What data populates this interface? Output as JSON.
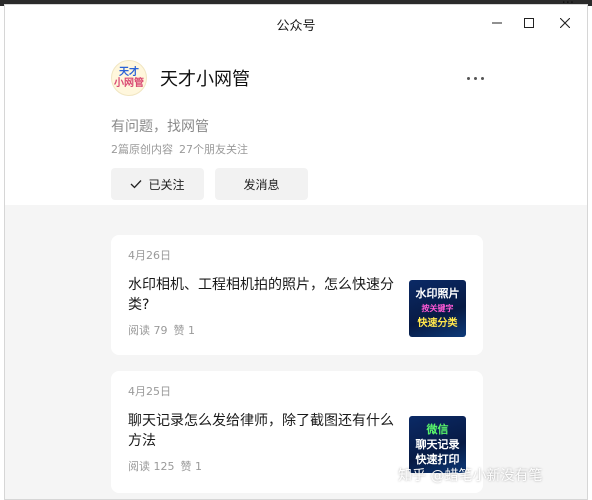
{
  "window": {
    "title": "公众号",
    "background_peek": "...",
    "controls": {
      "minimize_icon": "minimize-icon",
      "maximize_icon": "maximize-icon",
      "close_icon": "close-icon"
    }
  },
  "account": {
    "avatar_line1": "天才",
    "avatar_line2": "小网管",
    "name": "天才小网管",
    "intro": "有问题，找网管",
    "stats": {
      "original": "2篇原创内容",
      "friends": "27个朋友关注"
    }
  },
  "actions": {
    "follow_label": "已关注",
    "message_label": "发消息"
  },
  "articles": [
    {
      "date": "4月26日",
      "title": "水印相机、工程相机拍的照片，怎么快速分类?",
      "reads": "阅读 79",
      "likes": "赞 1",
      "thumb": [
        "水印照片",
        "按关键字",
        "快速分类"
      ]
    },
    {
      "date": "4月25日",
      "title": "聊天记录怎么发给律师，除了截图还有什么方法",
      "reads": "阅读 125",
      "likes": "赞 1",
      "thumb": [
        "微信",
        "聊天记录",
        "快速打印"
      ]
    }
  ],
  "watermark": "知乎 @蜡笔小新没有笔",
  "colors": {
    "feed_bg": "#f5f5f5",
    "button_bg": "#f2f2f2",
    "thumb_bg": "#0b2a66"
  }
}
